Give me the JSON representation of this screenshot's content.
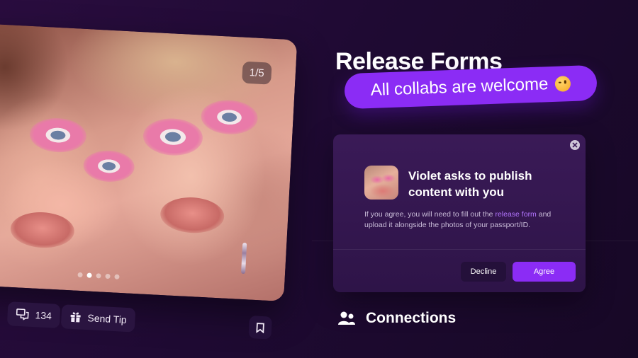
{
  "post": {
    "image_counter": "1/5",
    "slides": {
      "total": 5,
      "active_index": 1
    },
    "comments_count": "134",
    "tip_label": "Send Tip"
  },
  "release": {
    "section_title": "Release Forms",
    "banner_text": "All collabs are welcome"
  },
  "dialog": {
    "title": "Violet asks to publish content with you",
    "body_before": "If you agree, you will need to fill out the ",
    "link_text": "release form",
    "body_after": " and upload it alongside the photos of your passport/ID.",
    "decline_label": "Decline",
    "agree_label": "Agree"
  },
  "connections": {
    "label": "Connections"
  },
  "colors": {
    "accent": "#8b2cf5",
    "link": "#b375ff",
    "background": "#1f0a33",
    "card": "#3a1a57"
  }
}
